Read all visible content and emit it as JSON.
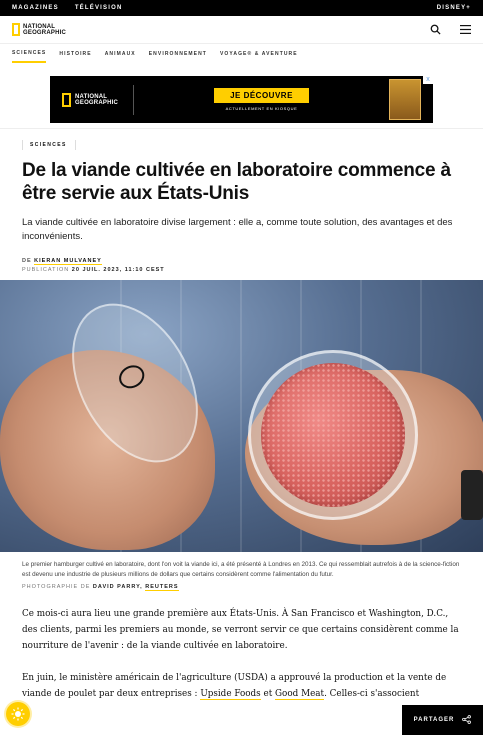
{
  "topbar": {
    "links": [
      "MAGAZINES",
      "TÉLÉVISION"
    ],
    "right": "DISNEY+"
  },
  "header": {
    "logo_line1": "NATIONAL",
    "logo_line2": "GEOGRAPHIC",
    "search_icon": "search-icon",
    "menu_icon": "hamburger-menu-icon"
  },
  "nav": {
    "items": [
      "SCIENCES",
      "HISTOIRE",
      "ANIMAUX",
      "ENVIRONNEMENT",
      "VOYAGE® & AVENTURE"
    ],
    "active": "SCIENCES"
  },
  "ad": {
    "logo_line1": "NATIONAL",
    "logo_line2": "GEOGRAPHIC",
    "button": "JE DÉCOUVRE",
    "subtext": "ACTUELLEMENT EN KIOSQUE",
    "close": "x",
    "brand_color": "#ffce00"
  },
  "article": {
    "kicker": "SCIENCES",
    "title": "De la viande cultivée en laboratoire commence à être servie aux États-Unis",
    "dek": "La viande cultivée en laboratoire divise largement : elle a, comme toute solution, des avantages et des inconvénients.",
    "byline_label": "DE",
    "author": "KIERAN MULVANEY",
    "pub_label": "PUBLICATION",
    "date": "20 JUIL. 2023, 11:10 CEST"
  },
  "image": {
    "caption": "Le premier hamburger cultivé en laboratoire, dont l'on voit la viande ici, a été présenté à Londres en 2013. Ce qui ressemblait autrefois à de la science-fiction est devenu une industrie de plusieurs millions de dollars que certains considèrent comme l'alimentation du futur.",
    "credit_label": "PHOTOGRAPHIE DE",
    "photographer": "DAVID PARRY,",
    "source": "REUTERS"
  },
  "body": {
    "p1": "Ce mois-ci aura lieu une grande première aux États-Unis. À San Francisco et Washington, D.C., des clients, parmi les premiers au monde, se verront servir ce que certains considèrent comme la nourriture de l'avenir : de la viande cultivée en laboratoire.",
    "p2_start": "En juin, le ministère américain de l'agriculture (USDA) a approuvé la production et la vente de viande de poulet par deux entreprises : ",
    "link1": "Upside Foods",
    "and": " et ",
    "link2": "Good Meat",
    "p2_end": ". Celles-ci s'associent"
  },
  "share": {
    "label": "PARTAGER",
    "icon": "share-icon"
  },
  "badge_icon": "sun-badge-icon"
}
